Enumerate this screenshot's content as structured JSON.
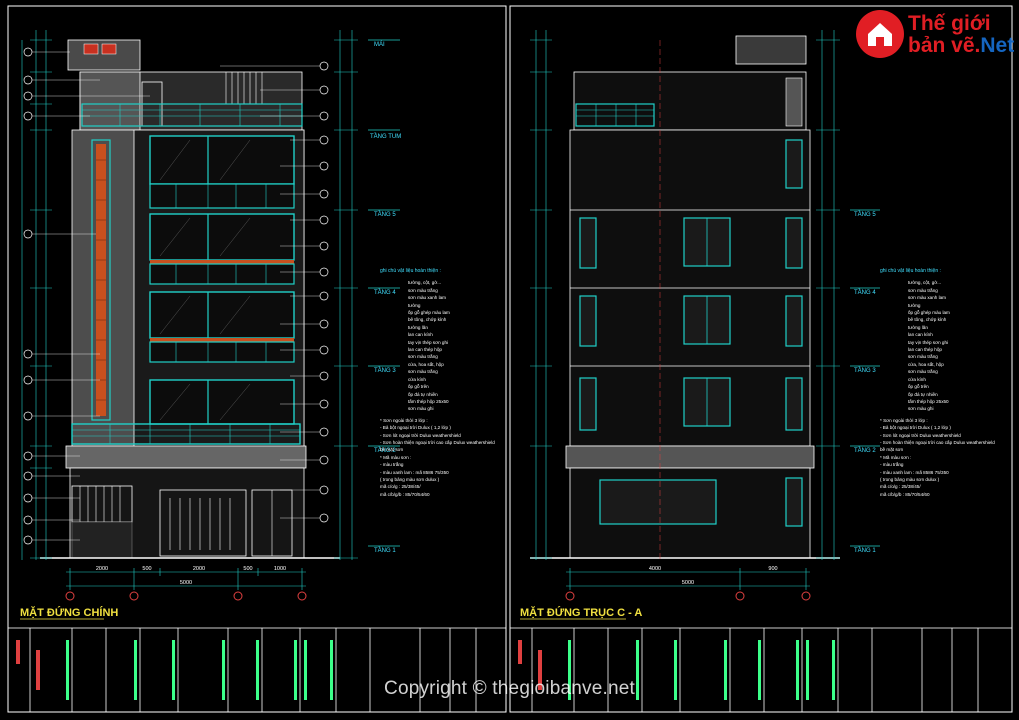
{
  "logo": {
    "line1": "Thế giới",
    "line2_main": "bản vẽ.",
    "line2_accent": "Net",
    "icon": "house-icon"
  },
  "watermark": "Copyright © thegioibanve.net",
  "colors": {
    "background": "#000000",
    "frame": "#ffffff",
    "accent_cyan": "#20d0c8",
    "accent_green": "#3cff8a",
    "wall_gray": "#555555",
    "brick": "#c8501e",
    "text_cyan": "#40e0ff",
    "title_yellow": "#f0e040"
  },
  "left_elevation": {
    "title": "MẶT ĐỨNG CHÍNH",
    "levels": [
      "MÁI",
      "TẦNG TUM",
      "TẦNG 5",
      "TẦNG 4",
      "TẦNG 3",
      "TẦNG 2",
      "TẦNG 1"
    ],
    "bottom_dims": [
      "2000",
      "500",
      "2000",
      "500",
      "1000",
      "5000"
    ]
  },
  "right_elevation": {
    "title": "MẶT ĐỨNG TRỤC C - A",
    "levels": [
      "TẦNG 5",
      "TẦNG 4",
      "TẦNG 3",
      "TẦNG 2",
      "TẦNG 1"
    ],
    "bottom_dims": [
      "4000",
      "900",
      "5000"
    ]
  },
  "notes": {
    "header": "ghi chú vật liệu hoàn thiện :",
    "items": [
      "tường, cột, gờ...",
      "sơn màu trắng",
      "sơn màu xanh lam",
      "tường",
      "ốp gỗ ghép màu lam",
      "bê tông, chớp kính",
      "tường lăn",
      "lan can kính",
      "tay vịn thép sơn ghi",
      "lan can thép hộp",
      "sơn màu trắng",
      "cửa, hoa sắt, hộp",
      "sơn màu trắng",
      "cửa kính",
      "ốp gỗ trên",
      "ốp đá tự nhiên",
      "tấm thép hộp 25x50",
      "sơn màu ghi"
    ],
    "footer": [
      "* Sơn ngoài thời 3 lớp :",
      "- Bả bột ngoại trời Dulux ( 1,2 lớp )",
      "- Sơn lót ngoại trời Dulux weathershield",
      "- Sơn hoàn thiện ngoại trời cao cấp Dulux weathershield",
      "  bề mặt sơn",
      "* Mã màu sơn :",
      "  - màu trắng",
      "  - màu xanh lam : mã 8586 75/350",
      "  ( trong bảng màu sơn dulux )",
      "  mã c/o/g : 25/38/45/",
      "  mã c/b/g/b : 85/70/54/60"
    ]
  }
}
